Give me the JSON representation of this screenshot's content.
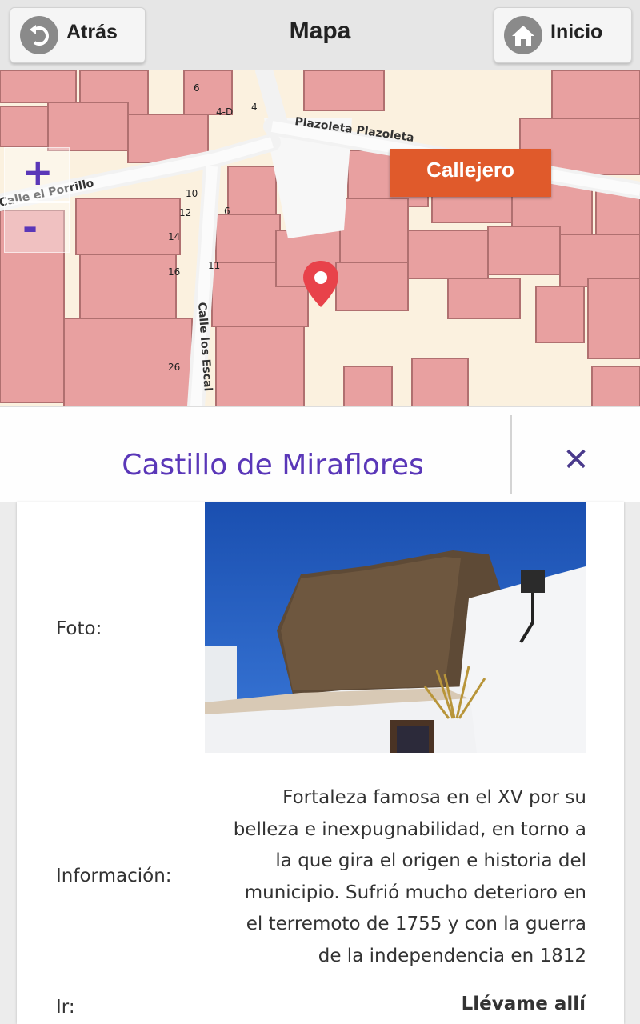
{
  "header": {
    "title": "Mapa",
    "back_label": "Atrás",
    "home_label": "Inicio",
    "back_icon": "back-arrow-icon",
    "home_icon": "home-icon"
  },
  "map": {
    "zoom_in": "+",
    "zoom_out": "-",
    "street_button": "Callejero",
    "streets": [
      "Calle el Porrillo",
      "Plazoleta Plazoleta",
      "Calle los Escal"
    ],
    "house_numbers": [
      "6",
      "4-D",
      "4",
      "10",
      "12",
      "6",
      "14",
      "16",
      "11",
      "26"
    ],
    "marker_icon": "location-pin-icon"
  },
  "place": {
    "title": "Castillo de Miraflores",
    "close_icon": "close-icon"
  },
  "details": {
    "photo_label": "Foto:",
    "info_label": "Información:",
    "info_lines": [
      "Fortaleza famosa en el XV por su",
      "belleza e inexpugnabilidad, en torno a",
      "la que gira el origen e historia del",
      "municipio. Sufrió mucho deterioro en",
      "el terremoto de 1755 y con la guerra",
      "de la independencia en 1812"
    ],
    "go_label": "Ir:",
    "go_link": "Llévame allí"
  },
  "colors": {
    "accent": "#5a37b8",
    "callejero": "#e05a2b",
    "building": "#e8a0a0",
    "marker": "#e8424a"
  }
}
